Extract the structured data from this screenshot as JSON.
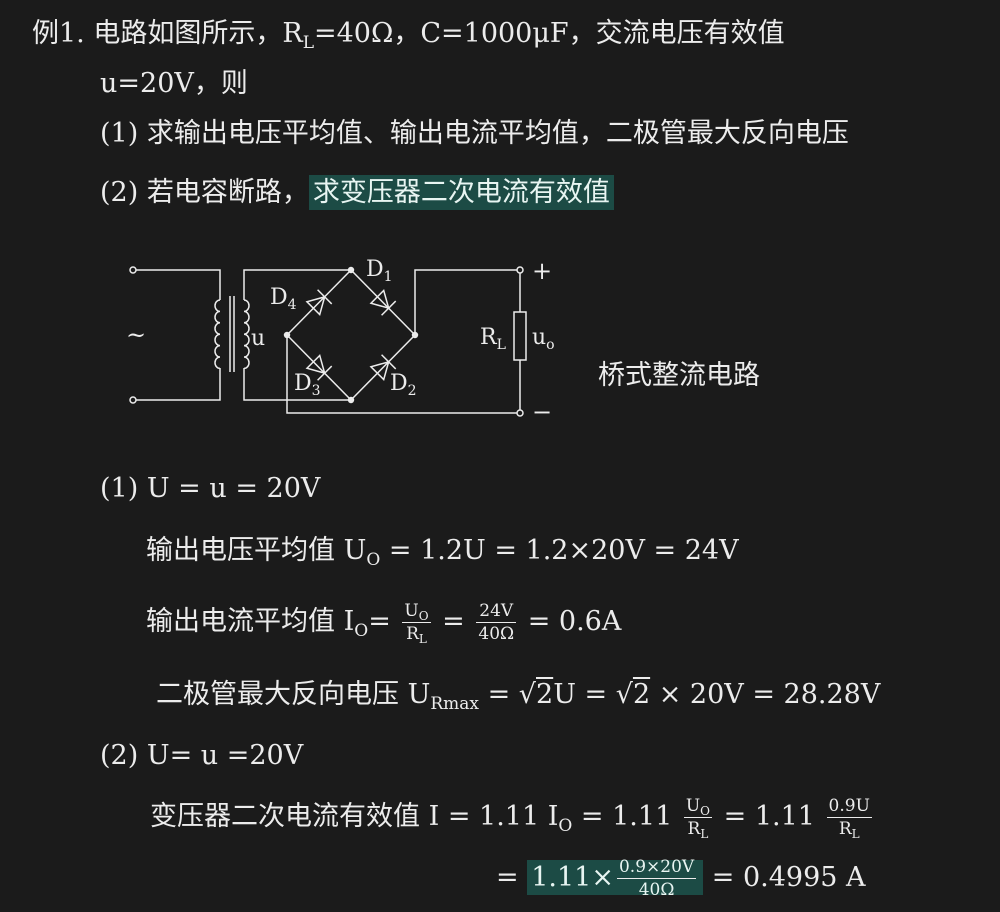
{
  "problem": {
    "label": "例1.",
    "line1_pre": "电路如图所示，R",
    "line1_sub": "L",
    "line1_post": "=40Ω，C=1000μF，交流电压有效值",
    "line2": "u=20V，则",
    "q1": "(1) 求输出电压平均值、输出电流平均值，二极管最大反向电压",
    "q2_pre": "(2) 若电容断路，",
    "q2_hl": "求变压器二次电流有效值"
  },
  "circuit": {
    "tilde": "~",
    "u": "u",
    "d1": "D",
    "d1_sub": "1",
    "d2": "D",
    "d2_sub": "2",
    "d3": "D",
    "d3_sub": "3",
    "d4": "D",
    "d4_sub": "4",
    "rl": "R",
    "rl_sub": "L",
    "uo": "u",
    "uo_sub": "o",
    "plus": "+",
    "minus": "−",
    "caption": "桥式整流电路"
  },
  "sol1": {
    "head": "(1) U = u = 20V",
    "l1_pre": "输出电压平均值 U",
    "l1_sub": "O",
    "l1_post": " = 1.2U = 1.2×20V = 24V",
    "l2_pre": "输出电流平均值 I",
    "l2_sub": "O",
    "l2_eq": "=",
    "f1_num": "U",
    "f1_num_sub": "O",
    "f1_den": "R",
    "f1_den_sub": "L",
    "f2_num": "24V",
    "f2_den": "40Ω",
    "l2_post": "= 0.6A",
    "l3_pre": "二极管最大反向电压 U",
    "l3_sub": "Rmax",
    "l3_a": " = √",
    "l3_b": "2",
    "l3_c": "U = √",
    "l3_d": "2",
    "l3_post": " × 20V = 28.28V"
  },
  "sol2": {
    "head": "(2) U= u =20V",
    "l1_pre": "变压器二次电流有效值 I = 1.11 I",
    "l1_sub": "O",
    "l1_mid": " = 1.11",
    "f1_num": "U",
    "f1_num_sub": "O",
    "f1_den": "R",
    "f1_den_sub": "L",
    "l1_mid2": "= 1.11",
    "f2_num": "0.9U",
    "f2_den": "R",
    "f2_den_sub": "L",
    "l2_eq": "=",
    "l2_hl": "1.11×",
    "f3_num": "0.9×20V",
    "f3_den": "40Ω",
    "l2_post": "= 0.4995 A"
  }
}
